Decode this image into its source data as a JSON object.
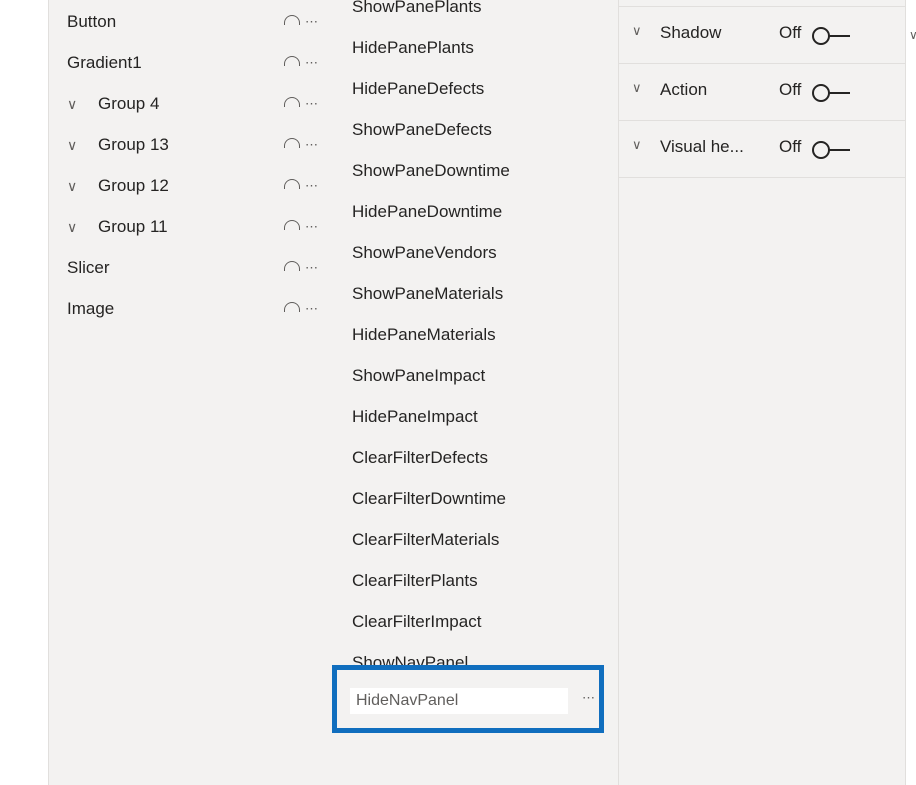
{
  "layers": [
    {
      "label": "Button",
      "group": false
    },
    {
      "label": "Gradient1",
      "group": false
    },
    {
      "label": "Group 4",
      "group": true
    },
    {
      "label": "Group 13",
      "group": true
    },
    {
      "label": "Group 12",
      "group": true
    },
    {
      "label": "Group 11",
      "group": true
    },
    {
      "label": "Slicer",
      "group": false
    },
    {
      "label": "Image",
      "group": false
    }
  ],
  "layer_icons": {
    "visibility": "eye-icon",
    "more": "⋯"
  },
  "bookmarks": [
    "ShowPanePlants",
    "HidePanePlants",
    "HidePaneDefects",
    "ShowPaneDefects",
    "ShowPaneDowntime",
    "HidePaneDowntime",
    "ShowPaneVendors",
    "ShowPaneMaterials",
    "HidePaneMaterials",
    "ShowPaneImpact",
    "HidePaneImpact",
    "ClearFilterDefects",
    "ClearFilterDowntime",
    "ClearFilterMaterials",
    "ClearFilterPlants",
    "ClearFilterImpact",
    "ShowNavPanel"
  ],
  "editing_bookmark": {
    "value": "HideNavPanel",
    "more": "⋯"
  },
  "format": [
    {
      "label": "Shadow",
      "state": "Off"
    },
    {
      "label": "Action",
      "state": "Off"
    },
    {
      "label": "Visual he...",
      "state": "Off"
    }
  ],
  "colors": {
    "highlight": "#106ebe",
    "panel": "#f3f2f1"
  }
}
